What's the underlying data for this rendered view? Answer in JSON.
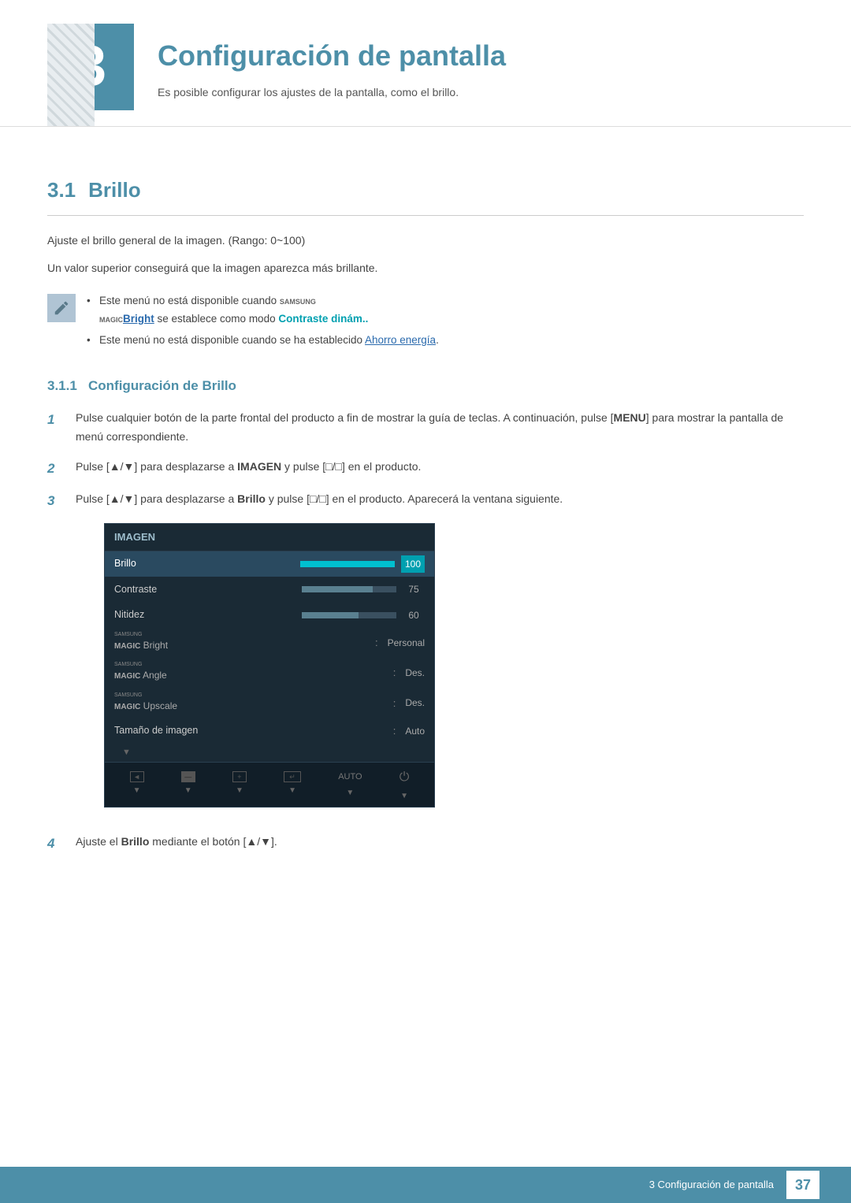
{
  "chapter": {
    "number": "3",
    "title": "Configuración de pantalla",
    "subtitle": "Es posible configurar los ajustes de la pantalla, como el brillo."
  },
  "section": {
    "number": "3.1",
    "title": "Brillo",
    "description1": "Ajuste el brillo general de la imagen. (Rango: 0~100)",
    "description2": "Un valor superior conseguirá que la imagen aparezca más brillante.",
    "notes": [
      "Este menú no está disponible cuando SAMSUNG MAGIC Bright se establece como modo Contraste dinám..",
      "Este menú no está disponible cuando se ha establecido Ahorro energía."
    ],
    "subsection": {
      "number": "3.1.1",
      "title": "Configuración de Brillo",
      "steps": [
        {
          "number": "1",
          "text": "Pulse cualquier botón de la parte frontal del producto a fin de mostrar la guía de teclas. A continuación, pulse [MENU] para mostrar la pantalla de menú correspondiente."
        },
        {
          "number": "2",
          "text": "Pulse [▲/▼] para desplazarse a IMAGEN y pulse [□/□] en el producto."
        },
        {
          "number": "3",
          "text": "Pulse [▲/▼] para desplazarse a Brillo y pulse [□/□] en el producto. Aparecerá la ventana siguiente."
        },
        {
          "number": "4",
          "text": "Ajuste el Brillo mediante el botón [▲/▼]."
        }
      ]
    }
  },
  "osd_menu": {
    "title": "IMAGEN",
    "rows": [
      {
        "label": "Brillo",
        "type": "bar",
        "value": 100,
        "max": 100,
        "percent": 100
      },
      {
        "label": "Contraste",
        "type": "bar",
        "value": 75,
        "max": 100,
        "percent": 75
      },
      {
        "label": "Nitidez",
        "type": "bar",
        "value": 60,
        "max": 100,
        "percent": 60
      },
      {
        "label": "SAMSUNG MAGIC Bright",
        "type": "text",
        "value": "Personal"
      },
      {
        "label": "SAMSUNG MAGIC Angle",
        "type": "text",
        "value": "Des."
      },
      {
        "label": "SAMSUNG MAGIC Upscale",
        "type": "text",
        "value": "Des."
      },
      {
        "label": "Tamaño de imagen",
        "type": "text",
        "value": "Auto"
      }
    ]
  },
  "footer": {
    "section_label": "3 Configuración de pantalla",
    "page_number": "37"
  }
}
